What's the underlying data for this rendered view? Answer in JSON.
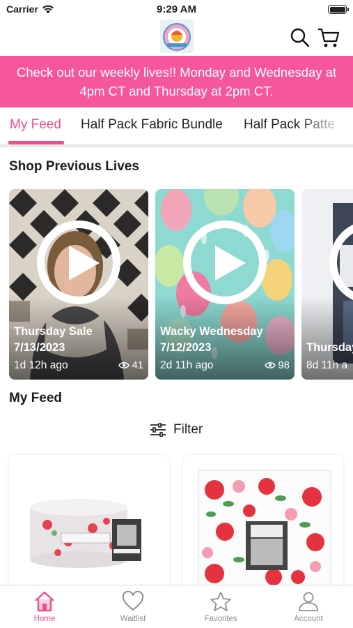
{
  "status_bar": {
    "carrier": "Carrier",
    "time": "9:29 AM"
  },
  "banner": {
    "text": "Check out our weekly lives!! Monday and Wednesday at 4pm CT and Thursday at 2pm CT."
  },
  "tabs": [
    {
      "label": "My Feed",
      "active": true
    },
    {
      "label": "Half Pack Fabric Bundle",
      "active": false
    },
    {
      "label": "Half Pack Patte",
      "active": false
    }
  ],
  "shop_previous_lives": {
    "title": "Shop Previous Lives",
    "cards": [
      {
        "title": "Thursday Sale",
        "date": "7/13/2023",
        "ago": "1d 12h ago",
        "views": "41"
      },
      {
        "title": "Wacky Wednesday",
        "date": "7/12/2023",
        "ago": "2d 11h ago",
        "views": "98"
      },
      {
        "title": "Thursday",
        "ago": "8d 11h a"
      }
    ]
  },
  "feed": {
    "title": "My Feed",
    "filter_label": "Filter"
  },
  "bottom_nav": [
    {
      "label": "Home",
      "active": true
    },
    {
      "label": "Waitlist",
      "active": false
    },
    {
      "label": "Favorites",
      "active": false
    },
    {
      "label": "Account",
      "active": false
    }
  ],
  "colors": {
    "accent": "#f24c8c",
    "banner": "#f6579a"
  }
}
